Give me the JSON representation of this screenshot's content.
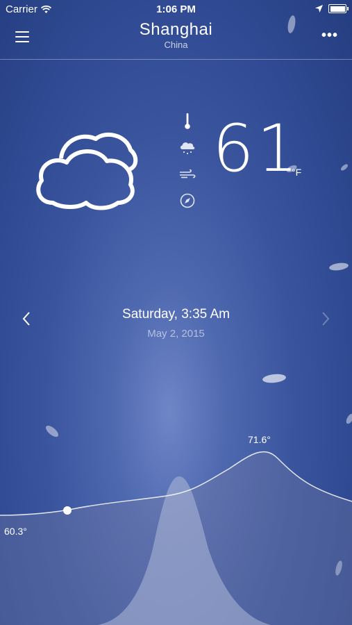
{
  "status_bar": {
    "carrier": "Carrier",
    "time": "1:06 PM"
  },
  "header": {
    "city": "Shanghai",
    "country": "China"
  },
  "current": {
    "temperature": "61",
    "unit": "°F",
    "condition_icon": "cloud-icon"
  },
  "date_nav": {
    "day_time": "Saturday, 3:35 Am",
    "date": "May 2, 2015"
  },
  "graph": {
    "max_label": "71.6°",
    "min_label": "60.3°"
  },
  "colors": {
    "background": "#3a559e",
    "accent": "#ffffff"
  }
}
